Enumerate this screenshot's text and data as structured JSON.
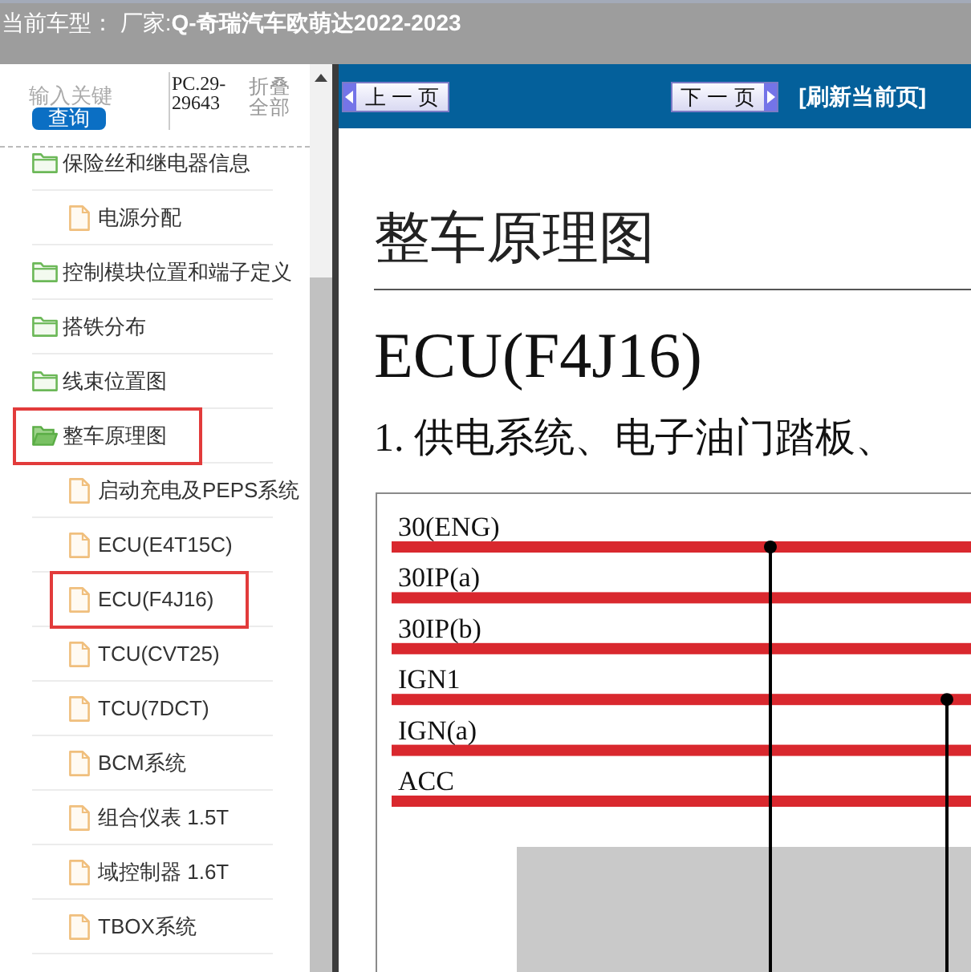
{
  "header": {
    "text": "当前车型： 厂家:**Q-奇瑞汽车欧萌达2022-2023**"
  },
  "sidebar": {
    "search": {
      "placeholder": "输入关键"
    },
    "search_button": "查询",
    "model_code": "PC.29-29643",
    "collapse_all": "折叠全部",
    "tree": [
      {
        "kind": "folder",
        "label": "保险丝和继电器信息",
        "expanded": false,
        "highlighted": false,
        "children": [
          {
            "kind": "page",
            "label": "电源分配",
            "highlighted": false
          }
        ]
      },
      {
        "kind": "folder",
        "label": "控制模块位置和端子定义",
        "expanded": false,
        "highlighted": false
      },
      {
        "kind": "folder",
        "label": "搭铁分布",
        "expanded": false,
        "highlighted": false
      },
      {
        "kind": "folder",
        "label": "线束位置图",
        "expanded": false,
        "highlighted": false
      },
      {
        "kind": "folder",
        "label": "整车原理图",
        "expanded": true,
        "highlighted": true,
        "children": [
          {
            "kind": "page",
            "label": "启动充电及PEPS系统",
            "highlighted": false
          },
          {
            "kind": "page",
            "label": "ECU(E4T15C)",
            "highlighted": false
          },
          {
            "kind": "page",
            "label": "ECU(F4J16)",
            "highlighted": true
          },
          {
            "kind": "page",
            "label": "TCU(CVT25)",
            "highlighted": false
          },
          {
            "kind": "page",
            "label": "TCU(7DCT)",
            "highlighted": false
          },
          {
            "kind": "page",
            "label": "BCM系统",
            "highlighted": false
          },
          {
            "kind": "page",
            "label": "组合仪表 1.5T",
            "highlighted": false
          },
          {
            "kind": "page",
            "label": "域控制器 1.6T",
            "highlighted": false
          },
          {
            "kind": "page",
            "label": "TBOX系统",
            "highlighted": false
          }
        ]
      }
    ]
  },
  "toolbar": {
    "previous": "上 一 页",
    "next": "下 一 页",
    "refresh": "[刷新当前页]"
  },
  "document": {
    "title": "整车原理图",
    "heading": "ECU(F4J16)",
    "section": "1. 供电系统、电子油门踏板、",
    "diagram": {
      "rails": [
        {
          "label": "30(ENG)"
        },
        {
          "label": "30IP(a)"
        },
        {
          "label": "30IP(b)"
        },
        {
          "label": "IGN1"
        },
        {
          "label": "IGN(a)"
        },
        {
          "label": "ACC"
        }
      ]
    }
  }
}
